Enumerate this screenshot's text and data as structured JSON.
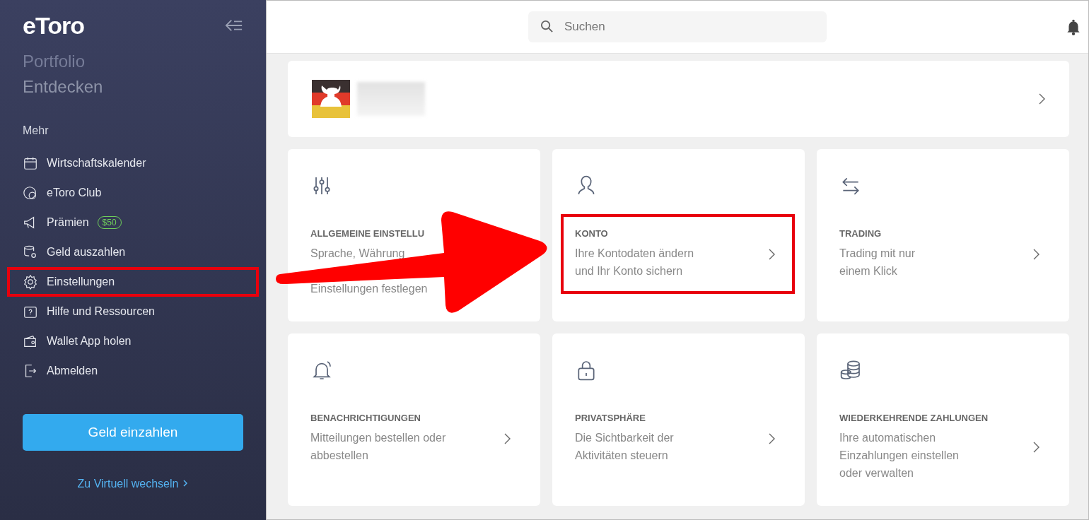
{
  "sidebar": {
    "logo": "eToro",
    "faded_items": [
      {
        "label": "Portfolio",
        "kind": "ghost"
      },
      {
        "label": "Entdecken",
        "kind": "dim"
      }
    ],
    "section_title": "Mehr",
    "items": [
      {
        "label": "Wirtschaftskalender",
        "kind": "calendar",
        "highlighted": false
      },
      {
        "label": "eToro Club",
        "kind": "club",
        "highlighted": false
      },
      {
        "label": "Prämien",
        "kind": "megaphone",
        "highlighted": false,
        "badge": "$50"
      },
      {
        "label": "Geld auszahlen",
        "kind": "coins-gear",
        "highlighted": false
      },
      {
        "label": "Einstellungen",
        "kind": "gear",
        "highlighted": true
      },
      {
        "label": "Hilfe und Ressourcen",
        "kind": "help",
        "highlighted": false
      },
      {
        "label": "Wallet App holen",
        "kind": "wallet",
        "highlighted": false
      },
      {
        "label": "Abmelden",
        "kind": "logout",
        "highlighted": false
      }
    ],
    "deposit_button": "Geld einzahlen",
    "virtual_link": "Zu Virtuell wechseln"
  },
  "search": {
    "placeholder": "Suchen"
  },
  "cards": [
    {
      "kind": "sliders",
      "title": "ALLGEMEINE EINSTELLU",
      "lines": [
        "Sprache, Währung",
        "Einstellungen festlegen"
      ],
      "highlighted": false
    },
    {
      "kind": "person",
      "title": "KONTO",
      "lines": [
        "Ihre Kontodaten ändern",
        "und Ihr Konto sichern"
      ],
      "highlighted": true
    },
    {
      "kind": "swap",
      "title": "TRADING",
      "lines": [
        "Trading mit nur",
        "einem Klick"
      ],
      "highlighted": false
    },
    {
      "kind": "bell",
      "title": "BENACHRICHTIGUNGEN",
      "lines": [
        "Mitteilungen bestellen oder",
        "abbestellen"
      ],
      "highlighted": false
    },
    {
      "kind": "lock",
      "title": "PRIVATSPHÄRE",
      "lines": [
        "Die Sichtbarkeit der",
        "Aktivitäten steuern"
      ],
      "highlighted": false
    },
    {
      "kind": "coins",
      "title": "WIEDERKEHRENDE ZAHLUNGEN",
      "lines": [
        "Ihre automatischen",
        "Einzahlungen einstellen",
        "oder verwalten"
      ],
      "highlighted": false
    }
  ]
}
